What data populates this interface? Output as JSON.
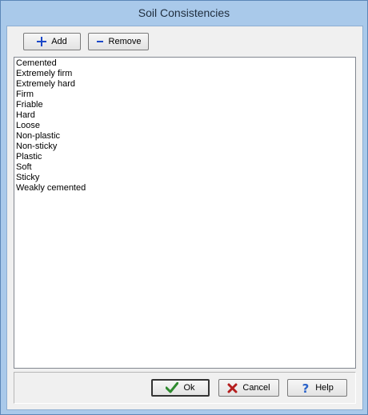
{
  "window": {
    "title": "Soil Consistencies"
  },
  "toolbar": {
    "add_label": "Add",
    "remove_label": "Remove",
    "add_icon": "plus-icon",
    "remove_icon": "minus-icon"
  },
  "list": {
    "items": [
      "Cemented",
      "Extremely firm",
      "Extremely hard",
      "Firm",
      "Friable",
      "Hard",
      "Loose",
      "Non-plastic",
      "Non-sticky",
      "Plastic",
      "Soft",
      "Sticky",
      "Weakly cemented"
    ]
  },
  "footer": {
    "ok_label": "Ok",
    "cancel_label": "Cancel",
    "help_label": "Help",
    "ok_icon": "checkmark-icon",
    "cancel_icon": "x-icon",
    "help_icon": "question-icon"
  },
  "colors": {
    "frame": "#a9c9ea",
    "plus": "#1a47c8",
    "minus": "#1a47c8",
    "check": "#2f8a2f",
    "cancel": "#b51e1e",
    "help": "#2b63c9"
  }
}
